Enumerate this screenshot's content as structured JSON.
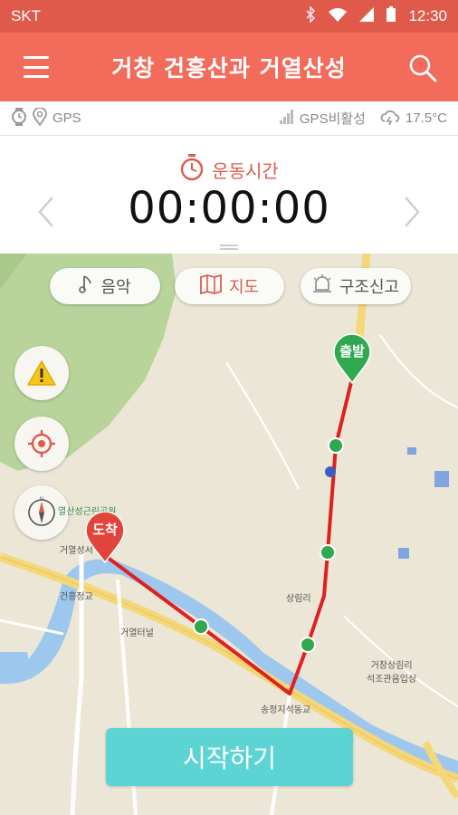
{
  "status_bar": {
    "carrier": "SKT",
    "time": "12:30"
  },
  "app_bar": {
    "title": "거창 건흥산과 거열산성"
  },
  "info_bar": {
    "gps_label": "GPS",
    "gps_status": "GPS비활성",
    "temperature": "17.5°C"
  },
  "timer": {
    "label": "운동시간",
    "value": "00:00:00"
  },
  "map_tabs": [
    {
      "label": "음악",
      "icon": "music-note-icon"
    },
    {
      "label": "지도",
      "icon": "map-icon",
      "active": true
    },
    {
      "label": "구조신고",
      "icon": "alarm-bell-icon"
    }
  ],
  "markers": {
    "start": "출발",
    "end": "도착"
  },
  "map_labels": {
    "park": "열산성근린공원",
    "fortress": "거열성서",
    "bridge": "건흥정교",
    "terminal": "거열터널",
    "village": "상림리",
    "school": "송정지석동교",
    "northwest": "거창상림리\n석조관음입상"
  },
  "start_button": {
    "label": "시작하기"
  },
  "colors": {
    "primary": "#f26b5b",
    "status_bar": "#e05a4b",
    "route": "#e02020",
    "waypoint": "#2fa84f",
    "start_marker": "#2fa84f",
    "end_marker": "#e0443a",
    "start_button": "#5dd4d4"
  }
}
